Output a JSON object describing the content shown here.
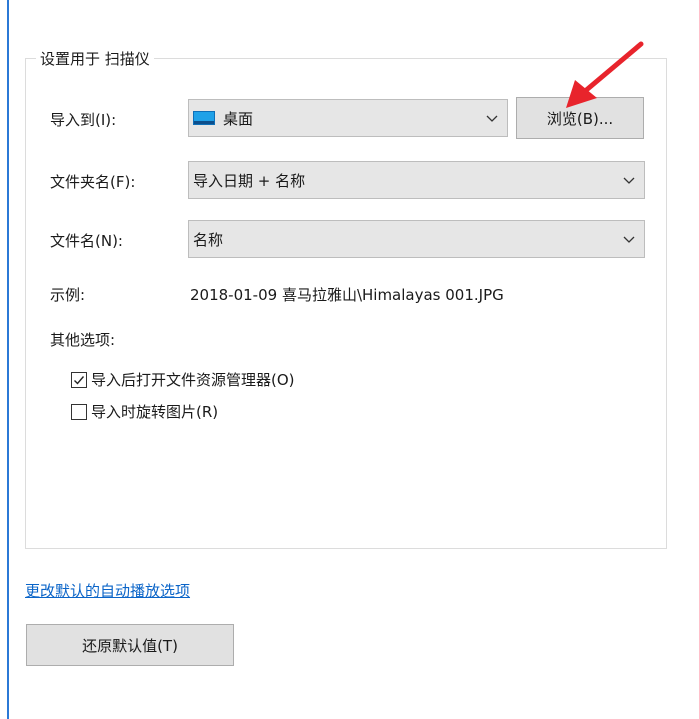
{
  "group": {
    "legend": "设置用于  扫描仪"
  },
  "import_to": {
    "label": "导入到(I):",
    "value": "桌面",
    "icon": "desktop-folder-icon"
  },
  "browse_button": {
    "label": "浏览(B)..."
  },
  "folder_name": {
    "label": "文件夹名(F):",
    "value": "导入日期 + 名称"
  },
  "file_name": {
    "label": "文件名(N):",
    "value": "名称"
  },
  "example": {
    "label": "示例:",
    "value": "2018-01-09 喜马拉雅山\\Himalayas 001.JPG"
  },
  "other_options": {
    "label": "其他选项:",
    "options": [
      {
        "label": "导入后打开文件资源管理器(O)",
        "checked": true
      },
      {
        "label": "导入时旋转图片(R)",
        "checked": false
      }
    ]
  },
  "autoplay_link": {
    "label": "更改默认的自动播放选项"
  },
  "restore_button": {
    "label": "还原默认值(T)"
  },
  "colors": {
    "accent_blue": "#2b79d6",
    "link_blue": "#0a64c8",
    "annotation_red": "#e8242c",
    "dropdown_bg": "#e6e6e6",
    "button_bg": "#e1e1e1"
  }
}
